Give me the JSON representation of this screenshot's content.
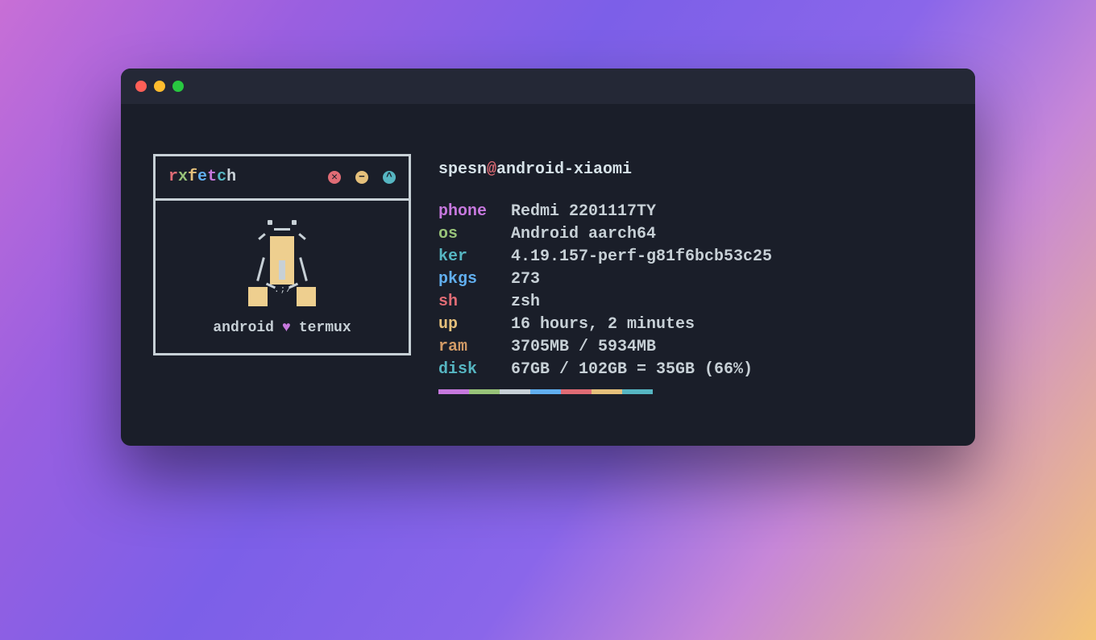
{
  "rxfetch_title_chars": [
    {
      "ch": "r",
      "color": "#e06c75"
    },
    {
      "ch": "x",
      "color": "#98c379"
    },
    {
      "ch": "f",
      "color": "#e5c07b"
    },
    {
      "ch": "e",
      "color": "#61afef"
    },
    {
      "ch": "t",
      "color": "#c678dd"
    },
    {
      "ch": "c",
      "color": "#56b6c2"
    },
    {
      "ch": "h",
      "color": "#c7d0d6"
    }
  ],
  "ctrl_glyphs": {
    "close": "✕",
    "min": "−",
    "up": "^"
  },
  "tag": {
    "left": "android",
    "heart": "♥",
    "right": "termux"
  },
  "user": {
    "name": "spesn",
    "at": "@",
    "host": "android-xiaomi"
  },
  "info": [
    {
      "key": "phone",
      "value": "Redmi 2201117TY",
      "color": "c-purple"
    },
    {
      "key": "os",
      "value": "Android aarch64",
      "color": "c-green"
    },
    {
      "key": "ker",
      "value": "4.19.157-perf-g81f6bcb53c25",
      "color": "c-cyan"
    },
    {
      "key": "pkgs",
      "value": "273",
      "color": "c-blue"
    },
    {
      "key": "sh",
      "value": "zsh",
      "color": "c-red"
    },
    {
      "key": "up",
      "value": "16 hours, 2 minutes",
      "color": "c-yellow"
    },
    {
      "key": "ram",
      "value": "3705MB / 5934MB",
      "color": "c-orange"
    },
    {
      "key": "disk",
      "value": "67GB / 102GB = 35GB (66%)",
      "color": "c-teal"
    }
  ],
  "swatches": [
    "#c678dd",
    "#98c379",
    "#c7d0d6",
    "#61afef",
    "#e06c75",
    "#e5c07b",
    "#56b6c2",
    "#1a1e29"
  ]
}
